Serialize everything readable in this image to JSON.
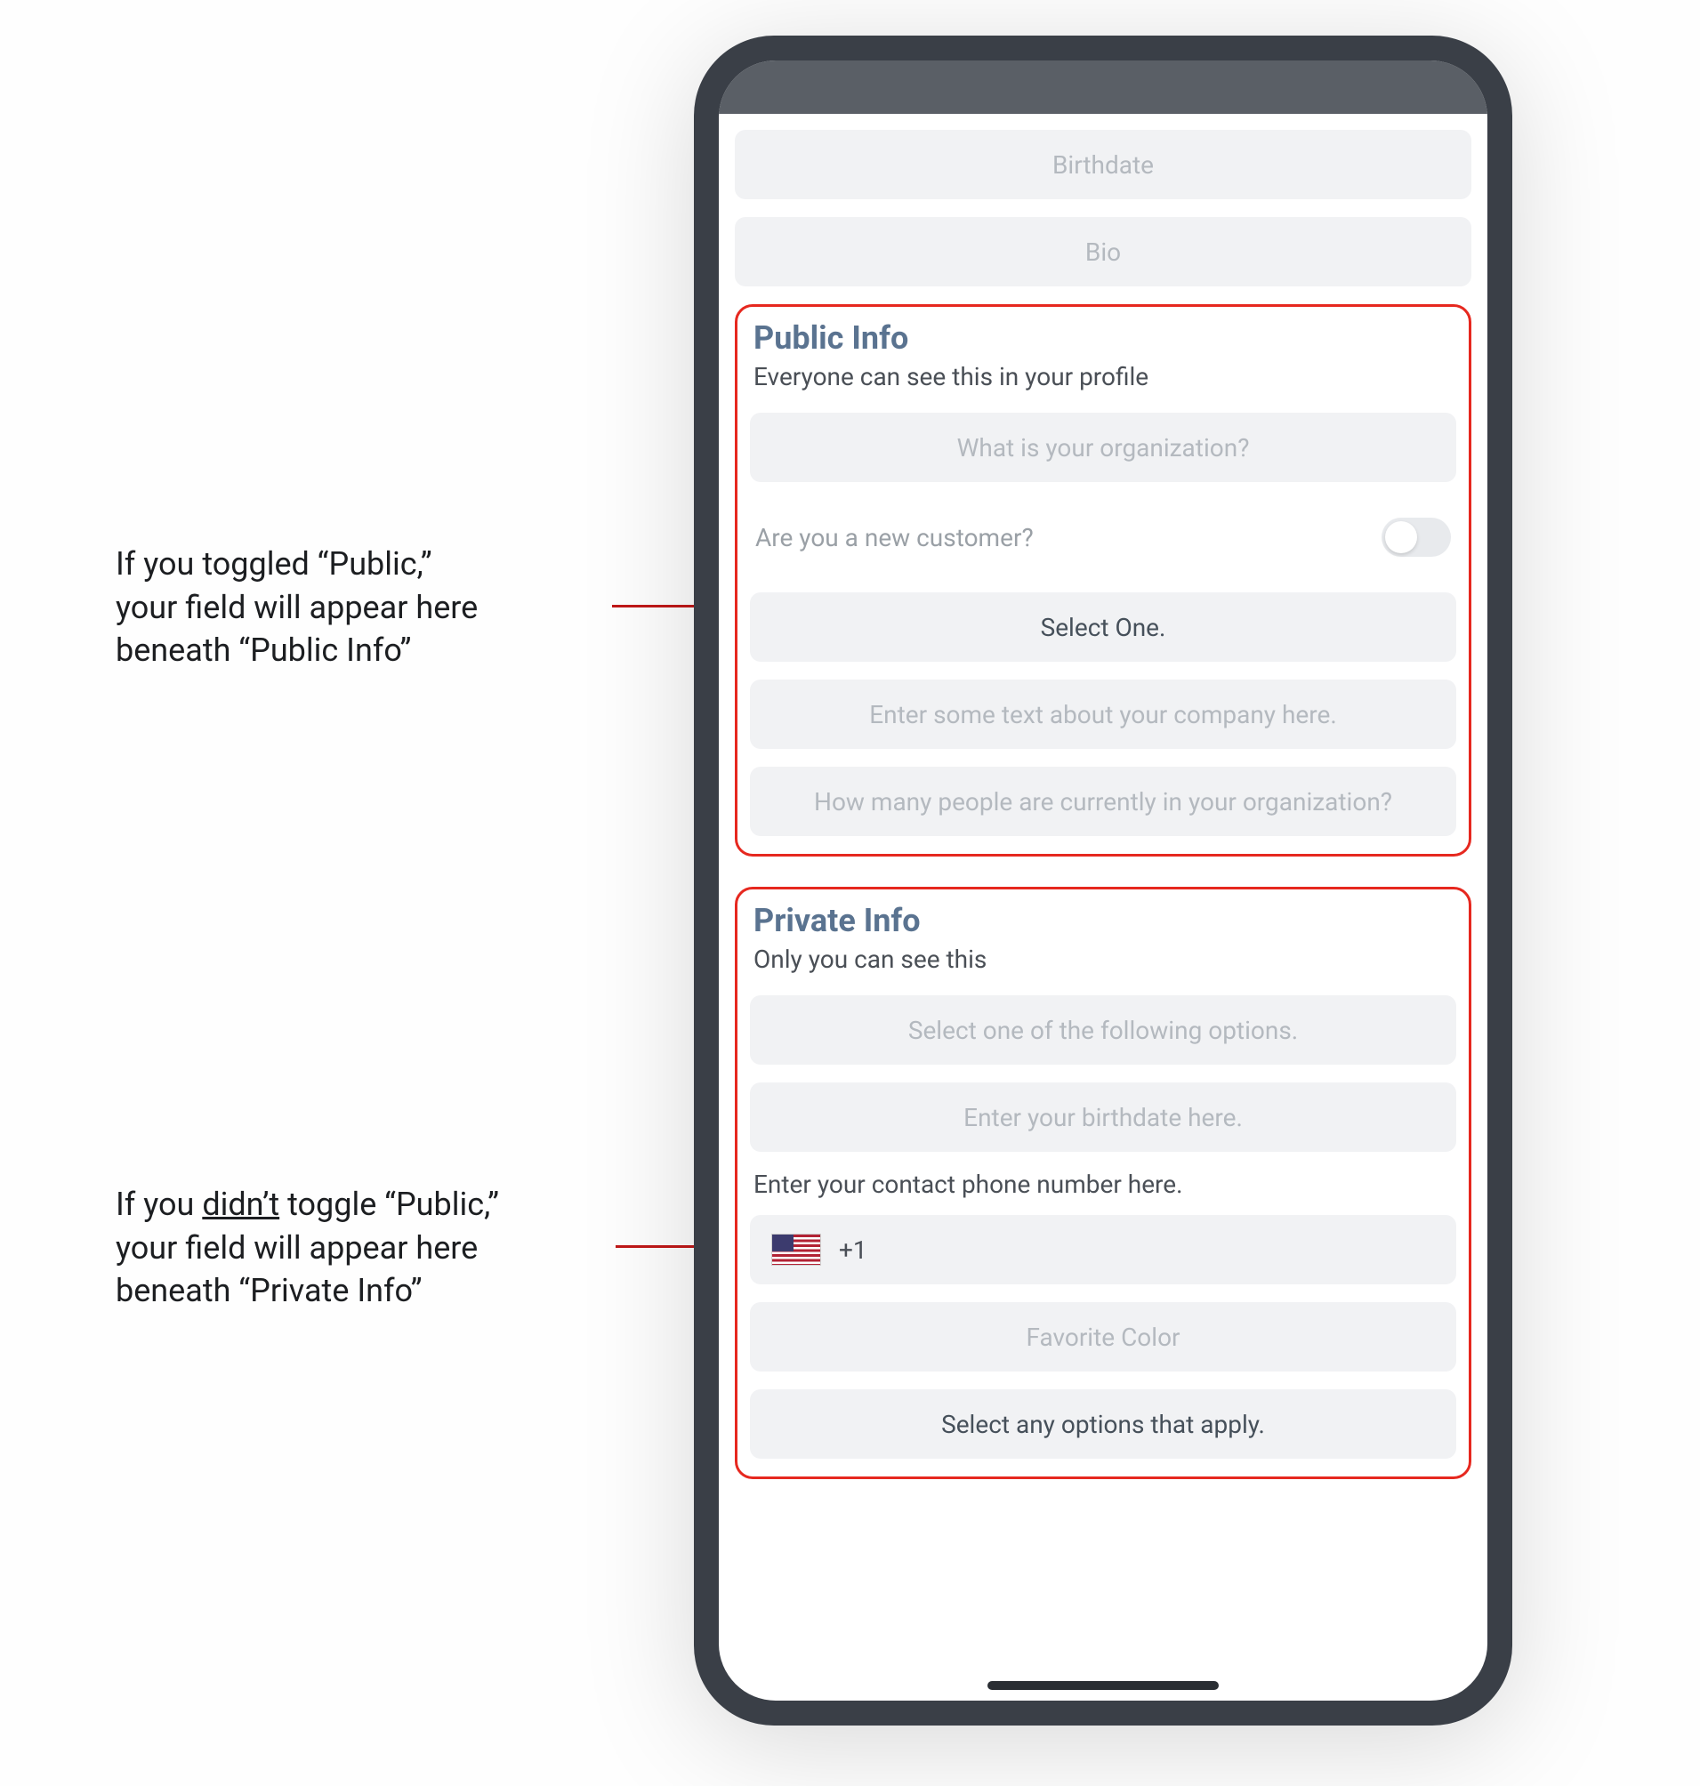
{
  "annotations": {
    "public": {
      "line1": "If you toggled “Public,”",
      "line2": "your field will appear here",
      "line3": "beneath “Public Info”"
    },
    "private": {
      "pre": "If you ",
      "underlined": "didn’t",
      "post": " toggle “Public,”",
      "line2": "your field will appear here",
      "line3": "beneath “Private Info”"
    }
  },
  "top_fields": {
    "birthdate": "Birthdate",
    "bio": "Bio"
  },
  "public_section": {
    "title": "Public Info",
    "subtitle": "Everyone can see this in your profile",
    "org_placeholder": "What is your organization?",
    "toggle_label": "Are you a new customer?",
    "select_one": "Select One.",
    "company_text": "Enter some text about your company here.",
    "people_count": "How many people are currently in your organization?"
  },
  "private_section": {
    "title": "Private Info",
    "subtitle": "Only you can see this",
    "select_options": "Select one of the following options.",
    "birthdate": "Enter your birthdate here.",
    "phone_label": "Enter your contact phone number here.",
    "country_code": "+1",
    "favorite_color": "Favorite Color",
    "select_apply": "Select any options that apply."
  }
}
